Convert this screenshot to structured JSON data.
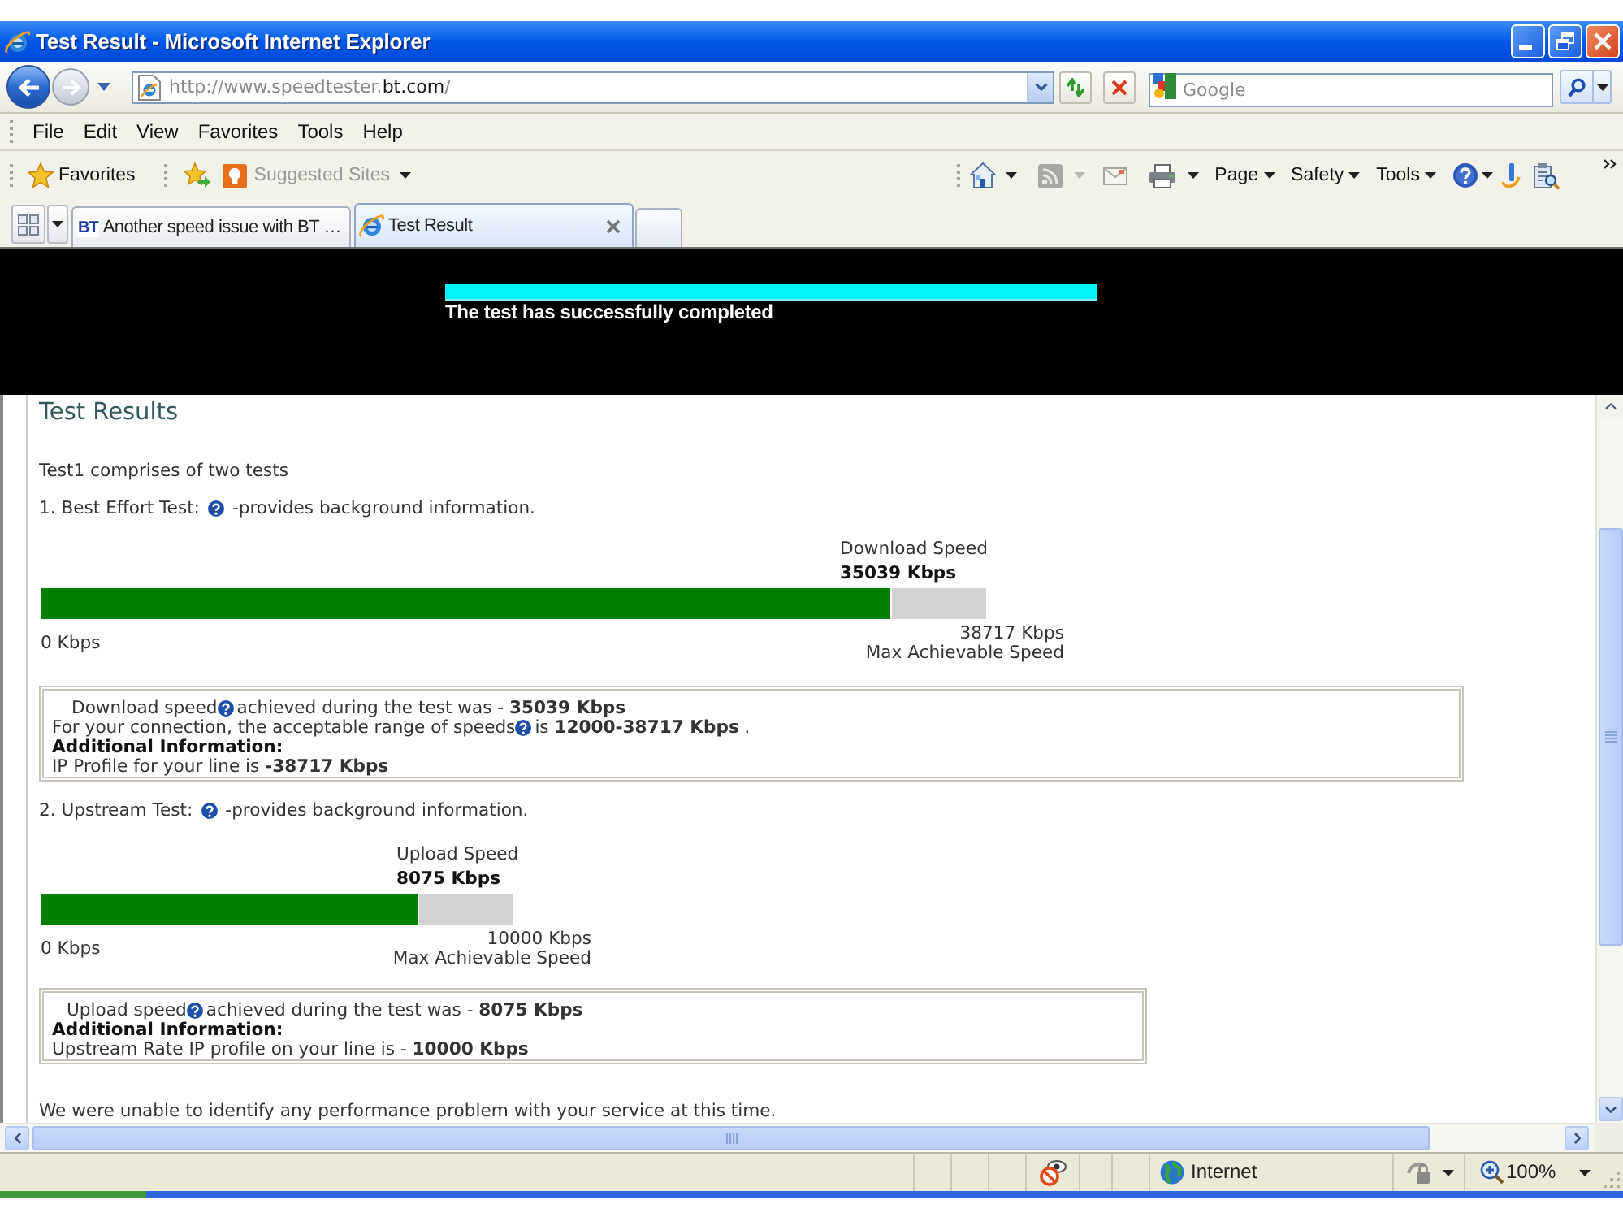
{
  "window": {
    "title": "Test Result - Microsoft Internet Explorer"
  },
  "address_bar": {
    "url_parts": [
      {
        "text": "http://www.speedtester.",
        "highlight": false
      },
      {
        "text": "bt.com",
        "highlight": true
      },
      {
        "text": "/",
        "highlight": false
      }
    ]
  },
  "search": {
    "placeholder": "Google"
  },
  "menu": [
    "File",
    "Edit",
    "View",
    "Favorites",
    "Tools",
    "Help"
  ],
  "favorites_bar": {
    "favorites": "Favorites",
    "suggested_sites": "Suggested Sites"
  },
  "command_bar": [
    "Page",
    "Safety",
    "Tools"
  ],
  "tabs": [
    {
      "label": "Another speed issue with BT …",
      "icon_text": "BT",
      "selected": false
    },
    {
      "label": "Test Result",
      "selected": true
    }
  ],
  "banner": {
    "progress": {
      "level": 1
    },
    "message": "The test has successfully completed"
  },
  "page": {
    "heading": "Test Results",
    "intro": "Test1 comprises of two tests",
    "tests": [
      {
        "title": "1. Best Effort Test:",
        "note": "-provides background information.",
        "meter": {
          "label": "Download Speed",
          "value": "35039 Kbps",
          "level": 0.9,
          "min": "0 Kbps",
          "max": "38717 Kbps",
          "max_caption": "Max Achievable Speed"
        },
        "details": [
          {
            "kind": "help",
            "before": "Download speed",
            "after": "achieved during the test was - **35039 Kbps**"
          },
          {
            "kind": "help",
            "before": "For your connection, the acceptable range of speeds",
            "after": "is **12000-38717 Kbps** ."
          },
          {
            "kind": "heading",
            "text": "Additional Information:"
          },
          {
            "kind": "text",
            "text": "IP Profile for your line is **-38717 Kbps**"
          }
        ]
      },
      {
        "title": "2. Upstream Test:",
        "note": "-provides background information.",
        "meter": {
          "label": "Upload Speed",
          "value": "8075 Kbps",
          "level": 0.8,
          "min": "0 Kbps",
          "max": "10000 Kbps",
          "max_caption": "Max Achievable Speed"
        },
        "details": [
          {
            "kind": "help",
            "before": "Upload speed",
            "after": "achieved during the test was - **8075 Kbps**"
          },
          {
            "kind": "heading",
            "text": "Additional Information:"
          },
          {
            "kind": "text",
            "text": "Upstream Rate IP profile on your line is - **10000 Kbps**"
          }
        ]
      }
    ],
    "conclusion": "We were unable to identify any performance problem with your service at this time."
  },
  "status_bar": {
    "zone": "Internet",
    "zoom": "100%"
  }
}
